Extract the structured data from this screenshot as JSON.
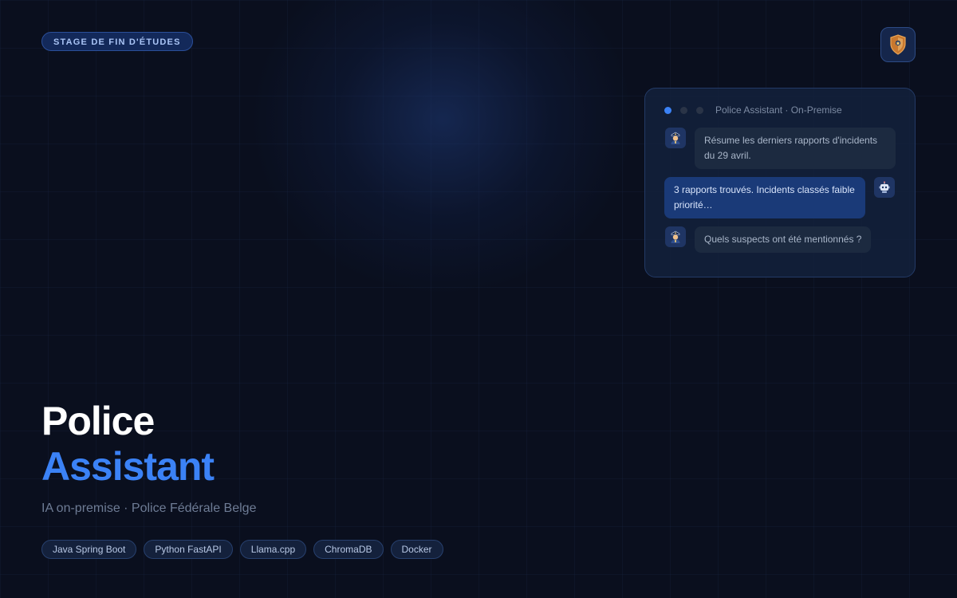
{
  "badge": {
    "label": "STAGE DE FIN D'ÉTUDES"
  },
  "logo": {
    "icon": "police-shield-icon"
  },
  "chat": {
    "title": "Police Assistant · On-Premise",
    "messages": [
      {
        "role": "user",
        "avatar_icon": "police-officer-icon",
        "text": "Résume les derniers rapports d'incidents du 29 avril."
      },
      {
        "role": "assistant",
        "avatar_icon": "robot-icon",
        "text": "3 rapports trouvés. Incidents classés faible priorité…"
      },
      {
        "role": "user",
        "avatar_icon": "police-officer-icon",
        "text": "Quels suspects ont été mentionnés ?"
      }
    ]
  },
  "hero": {
    "title_line1": "Police",
    "title_line2": "Assistant",
    "subtitle": "IA on-premise · Police Fédérale Belge"
  },
  "tags": [
    "Java Spring Boot",
    "Python FastAPI",
    "Llama.cpp",
    "ChromaDB",
    "Docker"
  ],
  "colors": {
    "background": "#0a0f1e",
    "accent": "#3b82f6",
    "badge_text": "#a9c4f5"
  }
}
